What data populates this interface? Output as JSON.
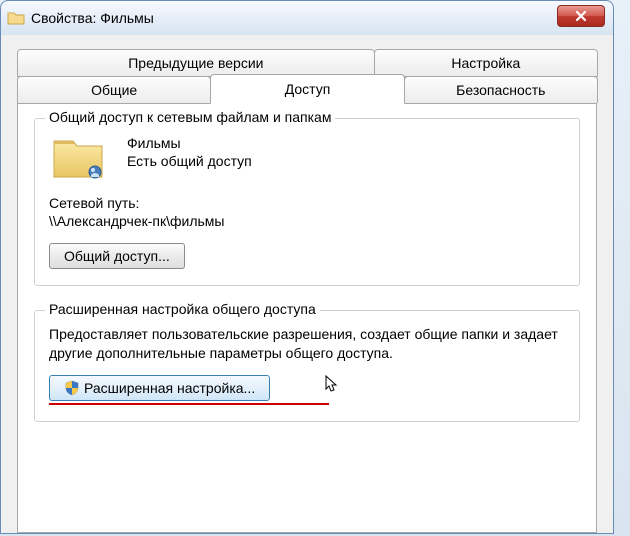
{
  "window": {
    "title": "Свойства: Фильмы"
  },
  "tabs": {
    "row1": [
      {
        "label": "Предыдущие версии"
      },
      {
        "label": "Настройка"
      }
    ],
    "row2": [
      {
        "label": "Общие"
      },
      {
        "label": "Доступ",
        "active": true
      },
      {
        "label": "Безопасность"
      }
    ]
  },
  "sharing": {
    "group_title": "Общий доступ к сетевым файлам и папкам",
    "folder_name": "Фильмы",
    "folder_status": "Есть общий доступ",
    "path_label": "Сетевой путь:",
    "path_value": "\\\\Александрчек-пк\\фильмы",
    "share_button": "Общий доступ..."
  },
  "advanced": {
    "group_title": "Расширенная настройка общего доступа",
    "description": "Предоставляет пользовательские разрешения, создает общие папки и задает другие дополнительные параметры общего доступа.",
    "button": "Расширенная настройка..."
  }
}
